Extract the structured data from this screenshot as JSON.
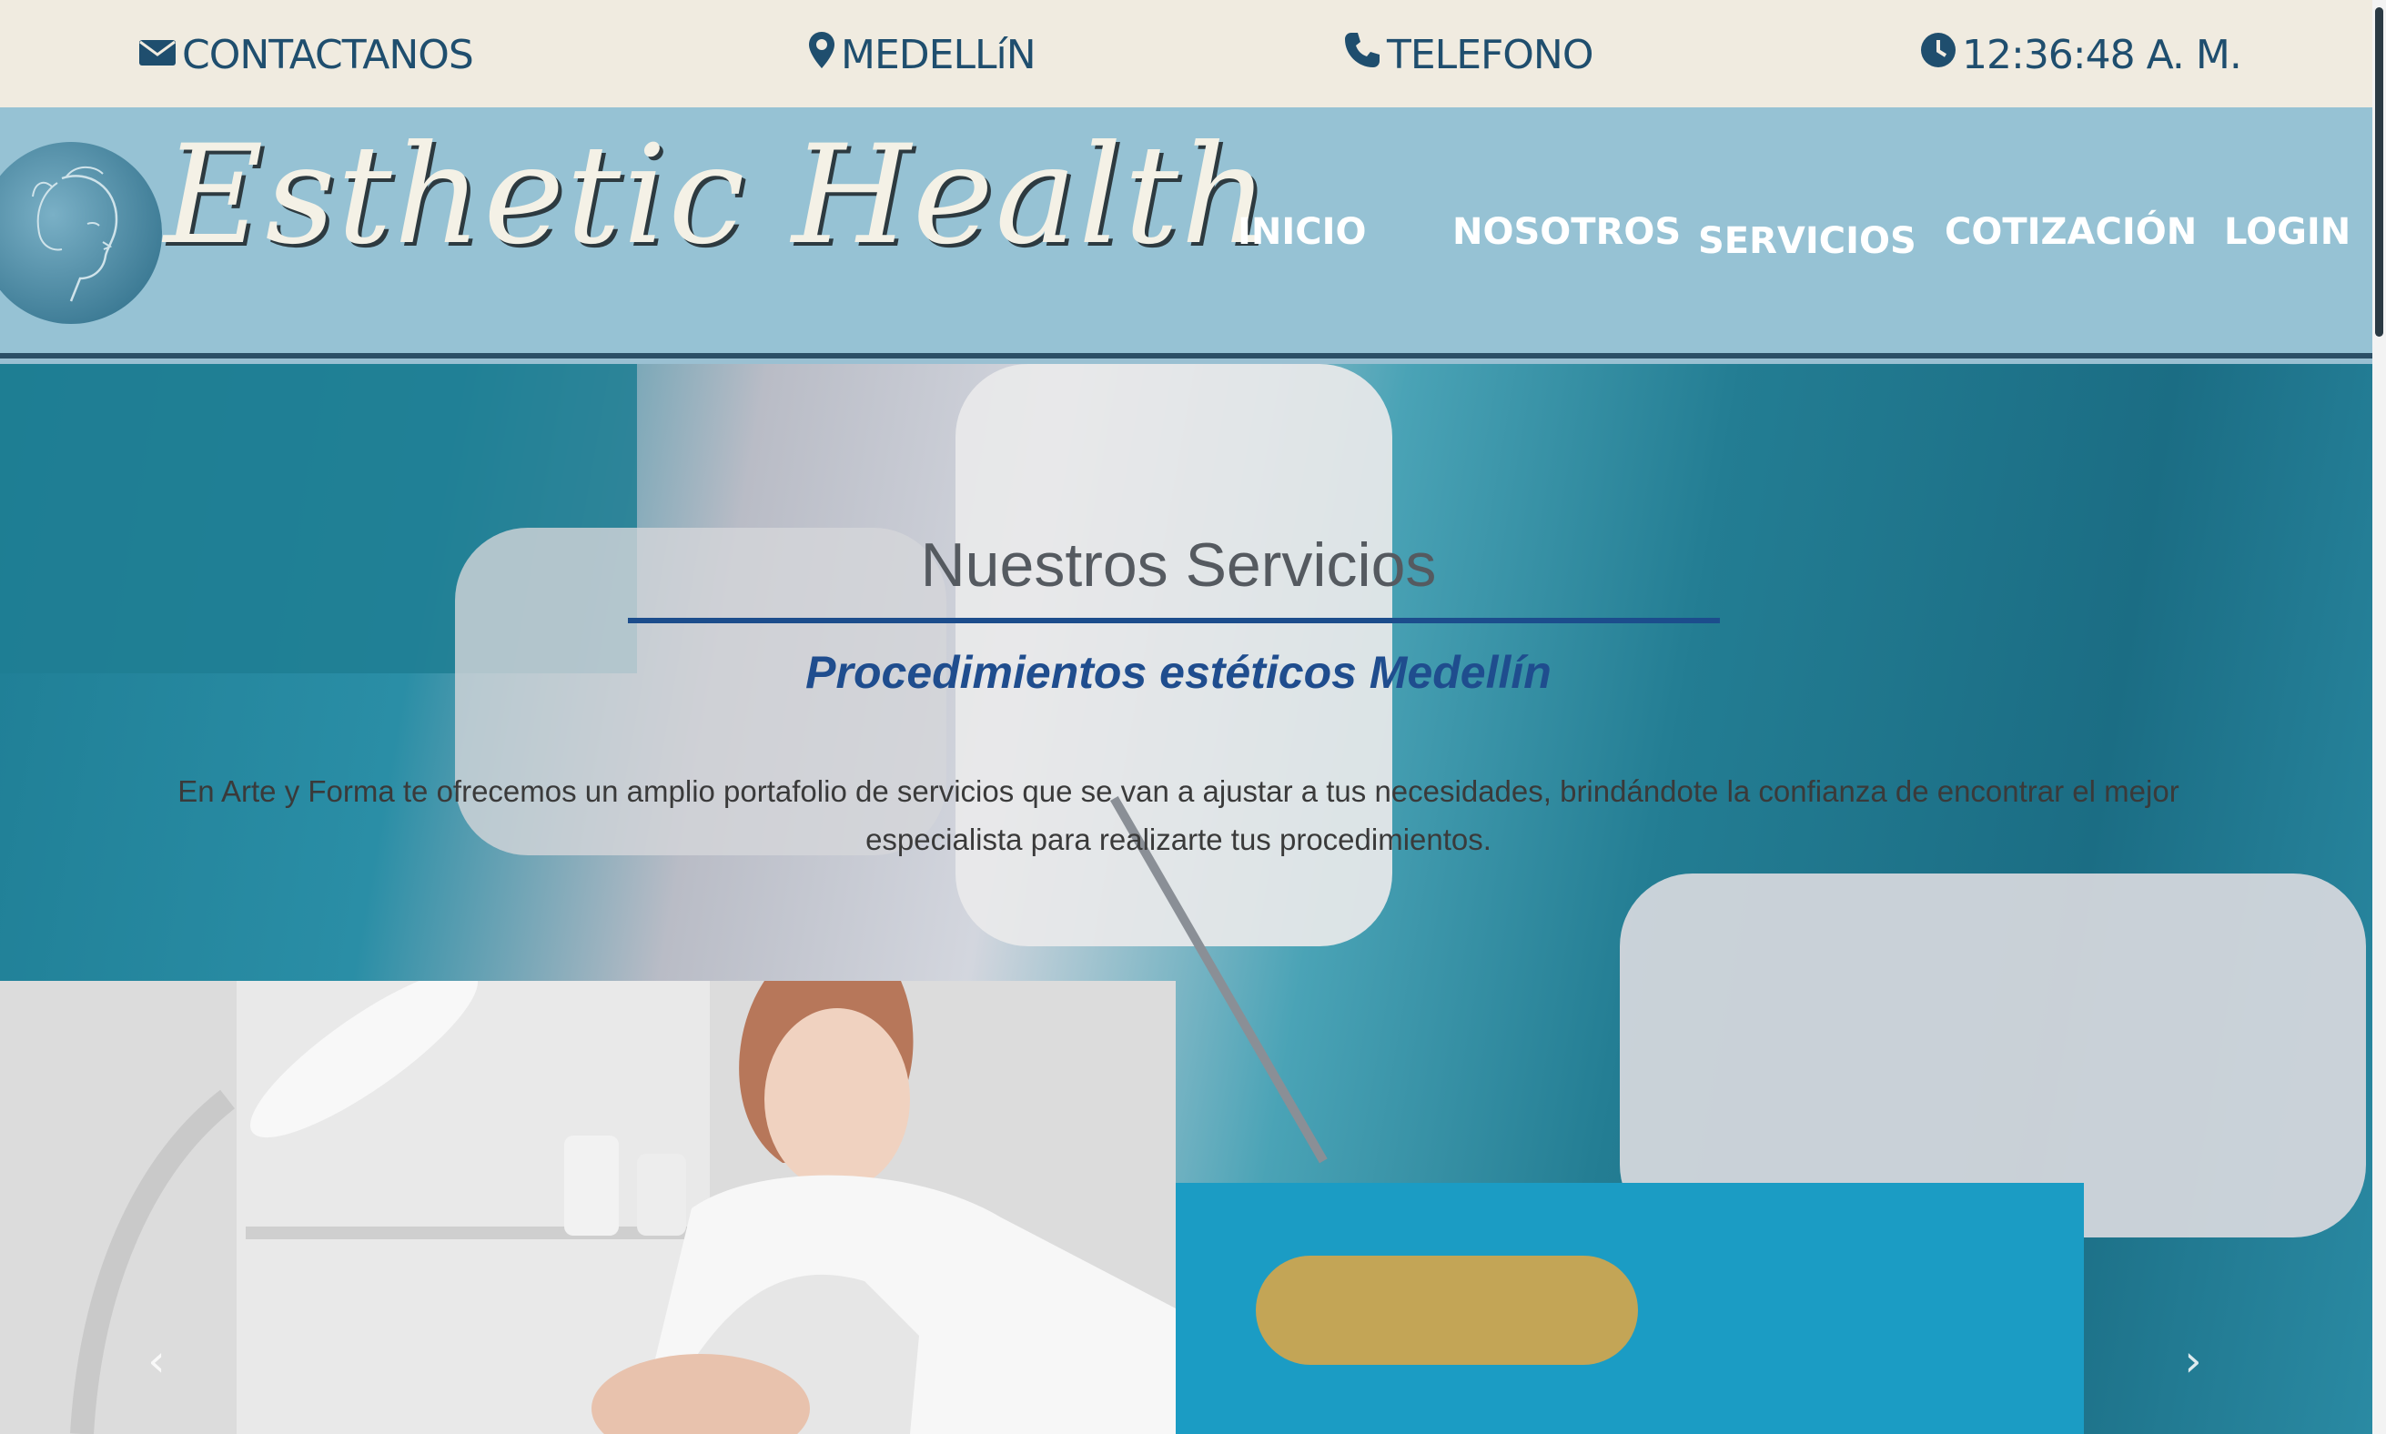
{
  "topbar": {
    "contact_label": "CONTACTANOS",
    "location_label": "MEDELLíN",
    "phone_label": "TELEFONO",
    "time_label": "12:36:48 A. M."
  },
  "header": {
    "brand": "Esthetic Health",
    "nav": {
      "inicio": "INICIO",
      "nosotros": "NOSOTROS",
      "servicios": "SERVICIOS",
      "cotizacion": "COTIZACIÓN",
      "login": "LOGIN"
    }
  },
  "hero": {
    "title": "Nuestros Servicios",
    "subtitle": "Procedimientos estéticos Medellín",
    "description": "En Arte y Forma te ofrecemos un amplio portafolio de servicios que se van a ajustar a tus necesidades, brindándote la confianza de encontrar el mejor especialista para realizarte tus procedimientos."
  },
  "carousel": {
    "prev_icon": "chevron-left-icon",
    "next_icon": "chevron-right-icon",
    "prev_glyph": "‹",
    "next_glyph": "›"
  },
  "colors": {
    "topbar_bg": "#f0ebe0",
    "header_bg": "#96c2d4",
    "accent_blue": "#1f4d8e",
    "topbar_text": "#1f4e6e"
  }
}
